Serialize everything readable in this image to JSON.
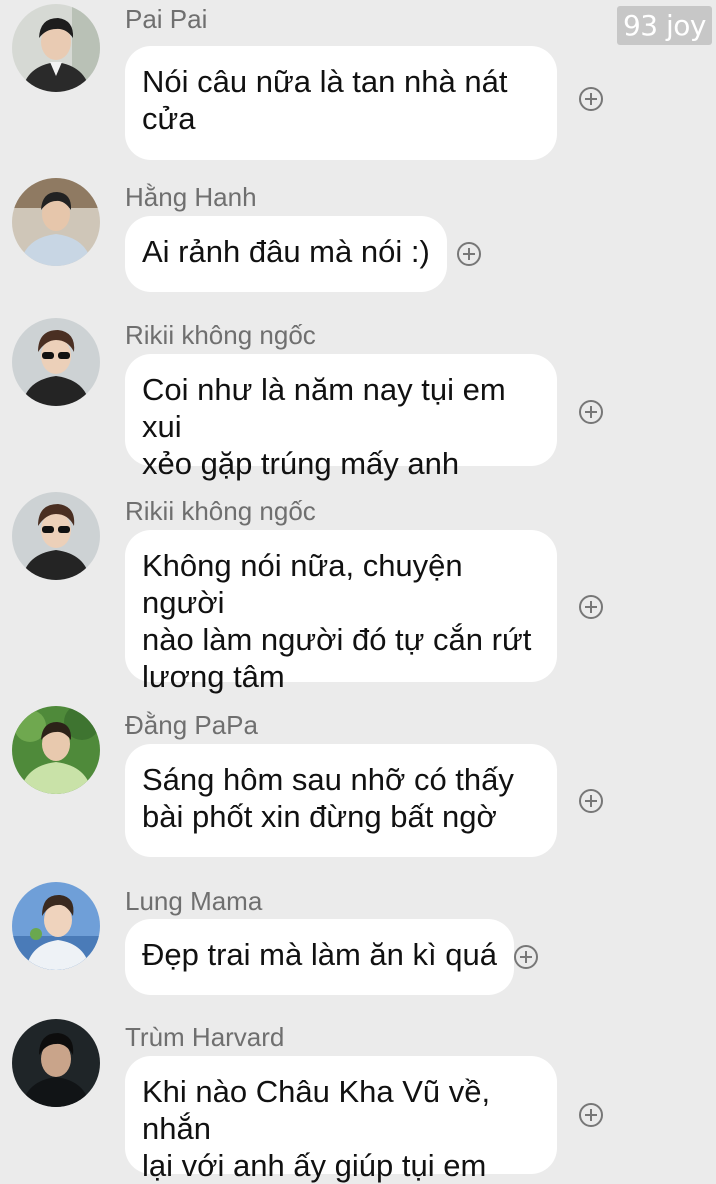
{
  "watermark": "93 joy",
  "messages": [
    {
      "name": "Pai Pai",
      "text": "Nói câu nữa là tan nhà nát\ncửa",
      "avatar": "avatar-pai-pai",
      "react_icon": "add-reaction-icon"
    },
    {
      "name": "Hằng Hanh",
      "text": "Ai rảnh đâu mà nói :)",
      "avatar": "avatar-hang-hanh",
      "react_icon": "add-reaction-icon"
    },
    {
      "name": "Rikii không ngốc",
      "text": "Coi như là năm nay tụi em xui\nxẻo gặp trúng mấy anh",
      "avatar": "avatar-rikii",
      "react_icon": "add-reaction-icon"
    },
    {
      "name": "Rikii không ngốc",
      "text": "Không nói nữa, chuyện người\nnào làm người đó tự cắn rứt\nlương tâm",
      "avatar": "avatar-rikii",
      "react_icon": "add-reaction-icon"
    },
    {
      "name": "Đằng PaPa",
      "text": "Sáng hôm sau nhỡ có thấy\nbài phốt xin đừng bất ngờ",
      "avatar": "avatar-dang-papa",
      "react_icon": "add-reaction-icon"
    },
    {
      "name": "Lung Mama",
      "text": "Đẹp trai mà làm ăn kì quá",
      "avatar": "avatar-lung-mama",
      "react_icon": "add-reaction-icon"
    },
    {
      "name": "Trùm Harvard",
      "text": "Khi nào Châu Kha Vũ về, nhắn\nlại với anh ấy giúp tụi em",
      "avatar": "avatar-trum-harvard",
      "react_icon": "add-reaction-icon"
    }
  ]
}
